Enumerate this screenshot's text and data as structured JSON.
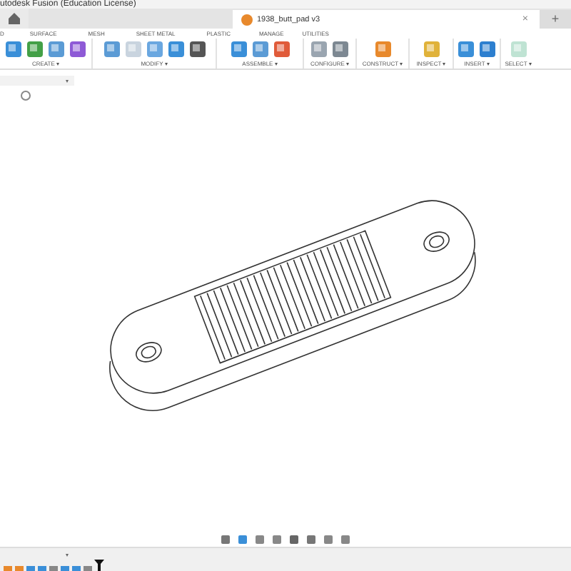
{
  "window": {
    "title": "utodesk Fusion (Education License)"
  },
  "document_tab": {
    "title": "1938_butt_pad v3",
    "close": "×",
    "new_tab": "+"
  },
  "toolbar_tabs": [
    {
      "label": "D"
    },
    {
      "label": "SURFACE"
    },
    {
      "label": "MESH"
    },
    {
      "label": "SHEET METAL"
    },
    {
      "label": "PLASTIC"
    },
    {
      "label": "MANAGE"
    },
    {
      "label": "UTILITIES"
    }
  ],
  "toolbar_groups": [
    {
      "label": "CREATE ▾"
    },
    {
      "label": "MODIFY ▾"
    },
    {
      "label": "ASSEMBLE ▾"
    },
    {
      "label": "CONFIGURE ▾"
    },
    {
      "label": "CONSTRUCT ▾"
    },
    {
      "label": "INSPECT ▾"
    },
    {
      "label": "INSERT ▾"
    },
    {
      "label": "SELECT ▾"
    }
  ],
  "browser": {
    "collapse": "▾"
  },
  "timeline_collapse": "▾"
}
